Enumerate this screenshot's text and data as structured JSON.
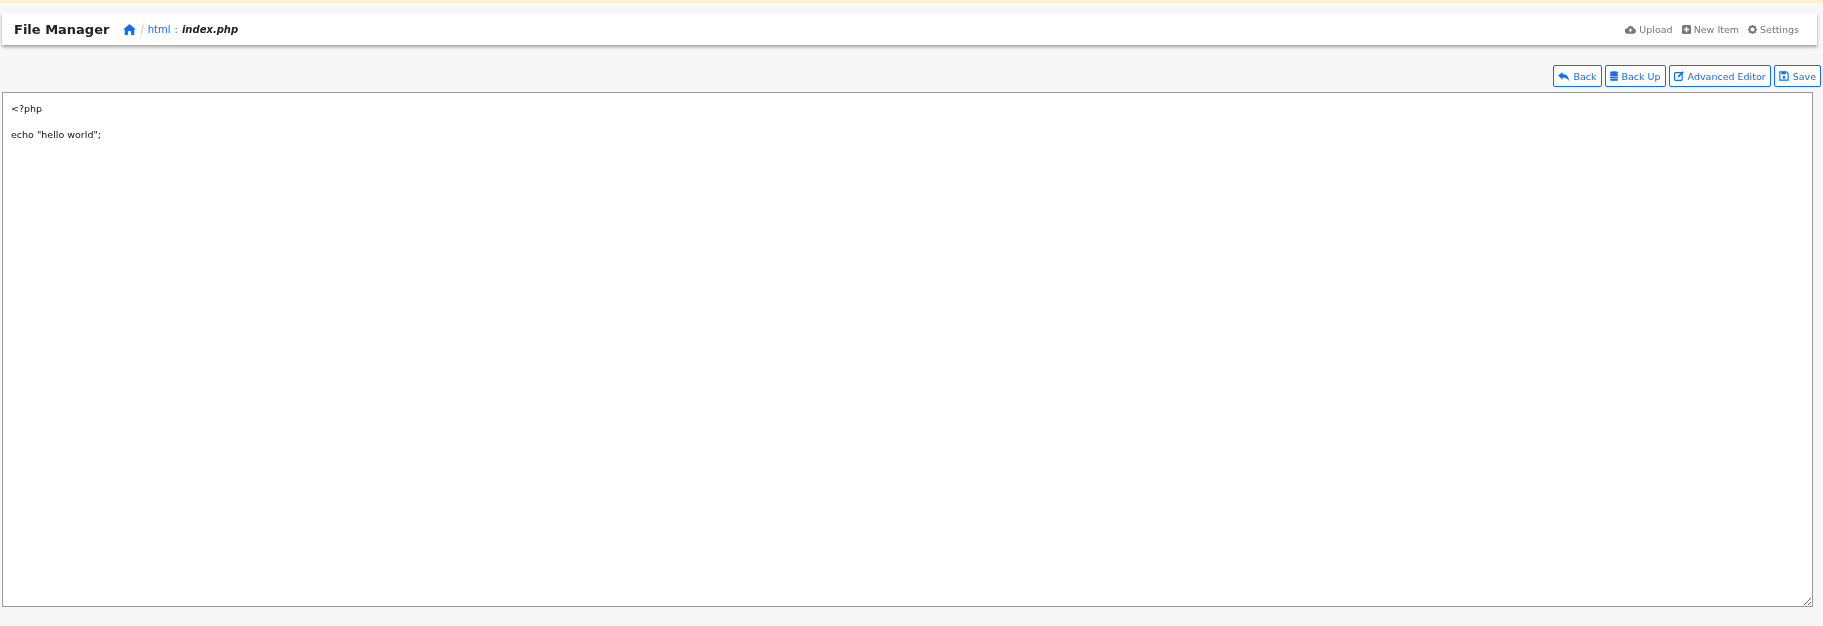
{
  "navbar": {
    "brand": "File Manager",
    "breadcrumb": [
      {
        "label": "/",
        "kind": "sep"
      },
      {
        "label": "html",
        "kind": "link"
      },
      {
        "label": ":",
        "kind": "colon"
      },
      {
        "label": "index.php",
        "kind": "current"
      }
    ],
    "actions": [
      {
        "label": "Upload",
        "kind": "upload"
      },
      {
        "label": "New Item",
        "kind": "new"
      },
      {
        "label": "Settings",
        "kind": "settings"
      }
    ]
  },
  "toolbar": [
    {
      "label": "Back",
      "kind": "back"
    },
    {
      "label": "Back Up",
      "kind": "backup"
    },
    {
      "label": "Advanced Editor",
      "kind": "edit"
    },
    {
      "label": "Save",
      "kind": "save"
    }
  ],
  "editor": {
    "content": "<?php\n\necho \"hello world\";"
  }
}
